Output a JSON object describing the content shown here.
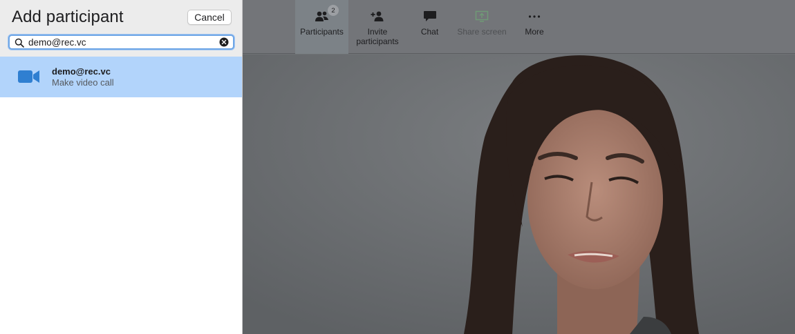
{
  "panel": {
    "title": "Add participant",
    "cancel_label": "Cancel",
    "search": {
      "value": "demo@rec.vc",
      "placeholder": ""
    },
    "result": {
      "name": "demo@rec.vc",
      "subtitle": "Make video call"
    }
  },
  "toolbar": {
    "participants": {
      "label": "Participants",
      "badge": "2"
    },
    "invite": {
      "label_line1": "Invite",
      "label_line2": "participants"
    },
    "chat": {
      "label": "Chat"
    },
    "share": {
      "label": "Share screen"
    },
    "more": {
      "label": "More"
    }
  },
  "colors": {
    "accent": "#2f7fd1",
    "selection": "#b2d4fb",
    "share_disabled": "#6f9a76"
  }
}
